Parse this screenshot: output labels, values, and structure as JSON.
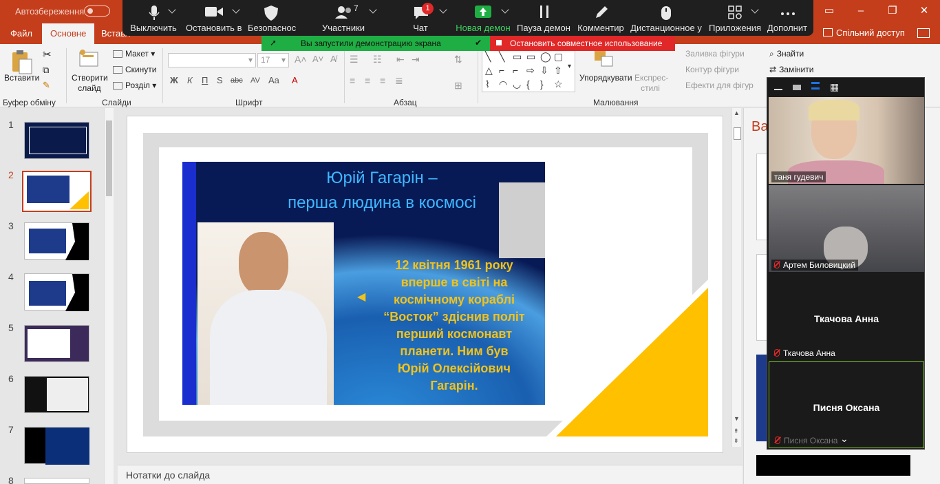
{
  "titlebar": {
    "autosave_label": "Автозбереження",
    "window_controls": [
      "restore-icon",
      "minimize-icon",
      "maximize-icon",
      "close-icon"
    ]
  },
  "ribbon_tabs": {
    "file": "Файл",
    "home": "Основне",
    "insert": "Вставл",
    "share": "Спільний доступ"
  },
  "ribbon": {
    "clipboard": {
      "paste": "Вставити",
      "label": "Буфер обміну"
    },
    "slides": {
      "new_slide": "Створити слайд",
      "layout": "Макет",
      "reset": "Скинути",
      "section": "Розділ",
      "label": "Слайди"
    },
    "font": {
      "font_name": "",
      "font_size": "17",
      "label": "Шрифт",
      "buttons": [
        "Ж",
        "К",
        "П",
        "S",
        "abc",
        "AV",
        "Aa",
        "A"
      ]
    },
    "paragraph": {
      "label": "Абзац"
    },
    "drawing": {
      "arrange": "Упорядкувати",
      "quick_styles": "Експрес-стилі",
      "fill": "Заливка фігури",
      "outline": "Контур фігури",
      "effects": "Ефекти для фігур",
      "label": "Малювання"
    },
    "editing": {
      "find": "Знайти",
      "replace": "Замінити"
    }
  },
  "slide_thumbnails": [
    {
      "num": "1"
    },
    {
      "num": "2",
      "selected": true
    },
    {
      "num": "3"
    },
    {
      "num": "4"
    },
    {
      "num": "5"
    },
    {
      "num": "6"
    },
    {
      "num": "7"
    },
    {
      "num": "8"
    }
  ],
  "slide": {
    "title_line1": "Юрій Гагарін –",
    "title_line2": "перша людина в космосі",
    "body_lines": [
      "12 квітня 1961 року",
      "вперше в світі на",
      "космічному кораблі",
      "“Восток” здіснив політ",
      "перший космонавт",
      "планети. Ним був",
      "Юрій Олексійович",
      "Гагарін."
    ],
    "colors": {
      "title": "#3fb7ff",
      "body": "#f2c21a",
      "accent": "#ffc000"
    }
  },
  "notes_placeholder": "Нотатки до слайда",
  "right_panel_text": "Ва",
  "zoom_toolbar": {
    "mute": "Выключить",
    "stop_video": "Остановить в",
    "security": "Безопаснос",
    "participants": "Участники",
    "participants_count": "7",
    "chat": "Чат",
    "chat_badge": "1",
    "new_share": "Новая демон",
    "pause_share": "Пауза демон",
    "annotate": "Комментир",
    "remote_control": "Дистанционное у",
    "apps": "Приложения",
    "more": "Дополнит"
  },
  "sharing_banner": "Вы запустили демонстрацию экрана",
  "stop_share": "Остановить совместное использование",
  "gallery": {
    "participants": [
      {
        "name": "таня гудевич",
        "video": true,
        "muted": false
      },
      {
        "name": "Артем Биловицкий",
        "video": true,
        "muted": true
      },
      {
        "name": "Ткачова Анна",
        "video": false,
        "muted": true
      },
      {
        "name": "Писня Оксана",
        "video": false,
        "muted": true
      }
    ]
  }
}
